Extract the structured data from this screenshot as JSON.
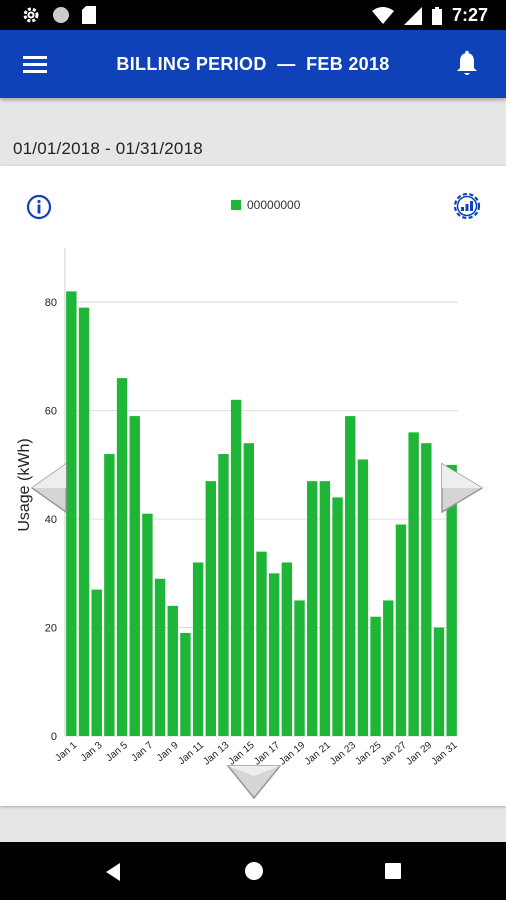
{
  "status_bar": {
    "time": "7:27",
    "icons": [
      "gear-icon",
      "circle-icon",
      "sd-card-icon",
      "wifi-icon",
      "signal-icon",
      "battery-icon"
    ]
  },
  "app_bar": {
    "title": "BILLING PERIOD  —  FEB 2018",
    "menu_icon": "hamburger-menu-icon",
    "bell_icon": "bell-icon",
    "color": "#0f42b8"
  },
  "period": {
    "date_range": "01/01/2018 - 01/31/2018"
  },
  "card": {
    "info_icon": "info-icon",
    "settings_icon": "settings-icon"
  },
  "chart_data": {
    "type": "bar",
    "series": [
      {
        "name": "00000000",
        "color": "#1fb536",
        "values": [
          82,
          79,
          27,
          52,
          66,
          59,
          41,
          29,
          24,
          19,
          32,
          47,
          52,
          62,
          54,
          34,
          30,
          32,
          25,
          47,
          47,
          44,
          59,
          51,
          22,
          25,
          39,
          56,
          54,
          20,
          50
        ]
      }
    ],
    "categories": [
      "Jan 1",
      "Jan 2",
      "Jan 3",
      "Jan 4",
      "Jan 5",
      "Jan 6",
      "Jan 7",
      "Jan 8",
      "Jan 9",
      "Jan 10",
      "Jan 11",
      "Jan 12",
      "Jan 13",
      "Jan 14",
      "Jan 15",
      "Jan 16",
      "Jan 17",
      "Jan 18",
      "Jan 19",
      "Jan 20",
      "Jan 21",
      "Jan 22",
      "Jan 23",
      "Jan 24",
      "Jan 25",
      "Jan 26",
      "Jan 27",
      "Jan 28",
      "Jan 29",
      "Jan 30",
      "Jan 31"
    ],
    "tick_labels": [
      "Jan 1",
      "Jan 3",
      "Jan 5",
      "Jan 7",
      "Jan 9",
      "Jan 11",
      "Jan 13",
      "Jan 15",
      "Jan 17",
      "Jan 19",
      "Jan 21",
      "Jan 23",
      "Jan 25",
      "Jan 27",
      "Jan 29",
      "Jan 31"
    ],
    "ylabel": "Usage (kWh)",
    "xlabel": "",
    "ylim": [
      0,
      90
    ],
    "yticks": [
      0,
      20,
      40,
      60,
      80
    ],
    "grid": true,
    "legend_position": "top-center"
  },
  "nav_arrows": {
    "left": "chevron-left-icon",
    "right": "chevron-right-icon",
    "down": "chevron-down-icon"
  },
  "system_nav": {
    "back": "back-icon",
    "home": "home-icon",
    "recents": "recents-icon"
  }
}
